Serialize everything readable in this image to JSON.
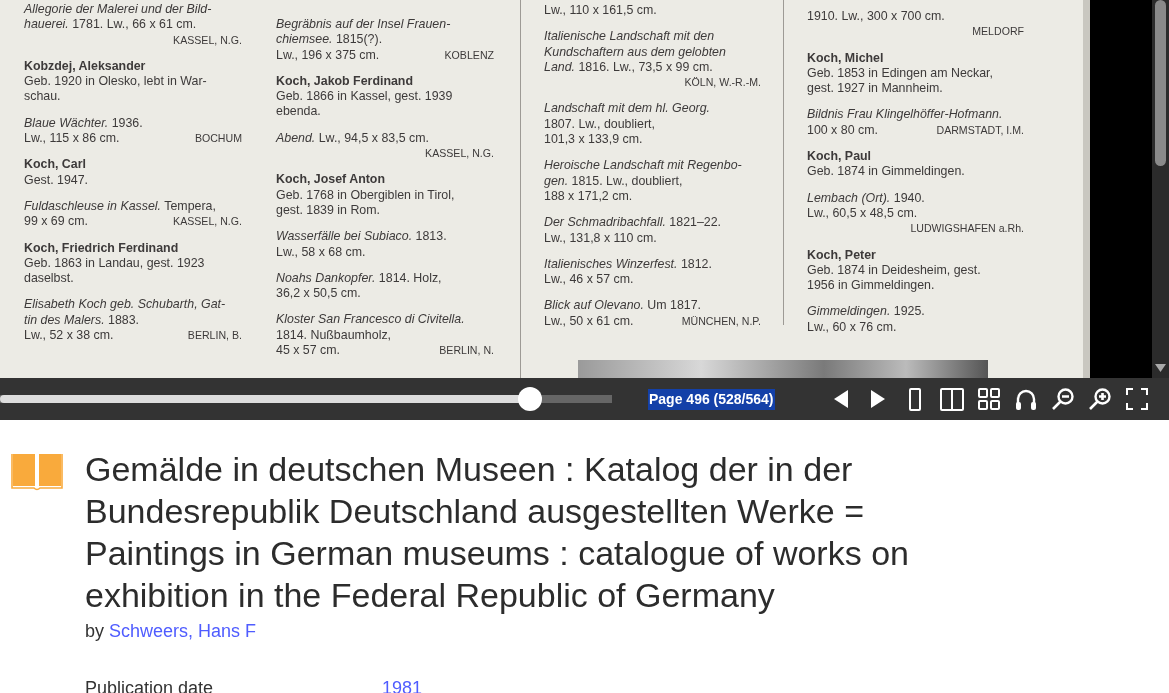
{
  "viewer": {
    "columns": [
      {
        "entries": [
          {
            "kind": "work",
            "lines": [
              {
                "text": "*Allegorie der Malerei und der Bild-*"
              },
              {
                "text": "*hauerei.* 1781. Lw., 66 x 61 cm."
              },
              {
                "location": "KASSEL, N.G."
              }
            ]
          },
          {
            "kind": "artist",
            "name": "Kobzdej, Aleksander",
            "lines": [
              {
                "text": "Geb. 1920 in Olesko, lebt in War-"
              },
              {
                "text": "schau."
              }
            ]
          },
          {
            "kind": "work",
            "lines": [
              {
                "text": "*Blaue Wächter.* 1936."
              },
              {
                "text": "Lw., 115 x 86 cm.",
                "location": "BOCHUM"
              }
            ]
          },
          {
            "kind": "artist",
            "name": "Koch, Carl",
            "lines": [
              {
                "text": "Gest. 1947."
              }
            ]
          },
          {
            "kind": "work",
            "lines": [
              {
                "text": "*Fuldaschleuse in Kassel.* Tempera,"
              },
              {
                "text": "99 x 69 cm.",
                "location": "KASSEL, N.G."
              }
            ]
          },
          {
            "kind": "artist",
            "name": "Koch, Friedrich Ferdinand",
            "lines": [
              {
                "text": "Geb. 1863 in Landau, gest. 1923"
              },
              {
                "text": "daselbst."
              }
            ]
          },
          {
            "kind": "work",
            "lines": [
              {
                "text": "*Elisabeth Koch geb. Schubarth, Gat-*"
              },
              {
                "text": "*tin des Malers.* 1883."
              },
              {
                "text": "Lw., 52 x 38 cm.",
                "location": "BERLIN, B."
              }
            ]
          }
        ]
      },
      {
        "entries": [
          {
            "kind": "work",
            "lines": [
              {
                "text": "*Begräbnis auf der Insel Frauen-*"
              },
              {
                "text": "*chiemsee.* 1815(?)."
              },
              {
                "text": "Lw., 196 x 375 cm.",
                "location": "KOBLENZ"
              }
            ]
          },
          {
            "kind": "artist",
            "name": "Koch, Jakob Ferdinand",
            "lines": [
              {
                "text": "Geb. 1866 in Kassel, gest. 1939"
              },
              {
                "text": "ebenda."
              }
            ]
          },
          {
            "kind": "work",
            "lines": [
              {
                "text": "*Abend.* Lw., 94,5 x 83,5 cm."
              },
              {
                "location": "KASSEL, N.G."
              }
            ]
          },
          {
            "kind": "artist",
            "name": "Koch, Josef Anton",
            "lines": [
              {
                "text": "Geb. 1768 in Obergiblen in Tirol,"
              },
              {
                "text": "gest. 1839 in Rom."
              }
            ]
          },
          {
            "kind": "work",
            "lines": [
              {
                "text": "*Wasserfälle bei Subiaco.* 1813."
              },
              {
                "text": "Lw., 58 x 68 cm."
              }
            ]
          },
          {
            "kind": "work",
            "lines": [
              {
                "text": "*Noahs Dankopfer.* 1814. Holz,"
              },
              {
                "text": "36,2 x 50,5 cm."
              }
            ]
          },
          {
            "kind": "work",
            "lines": [
              {
                "text": "*Kloster San Francesco di Civitella.*"
              },
              {
                "text": "1814. Nußbaumholz,"
              },
              {
                "text": "45 x 57 cm.",
                "location": "BERLIN, N."
              }
            ]
          }
        ]
      },
      {
        "entries": [
          {
            "kind": "work",
            "lines": [
              {
                "text": "Lw., 110 x 161,5 cm."
              }
            ]
          },
          {
            "kind": "work",
            "lines": [
              {
                "text": "*Italienische Landschaft mit den*"
              },
              {
                "text": "*Kundschaftern aus dem gelobten*"
              },
              {
                "text": "*Land.* 1816. Lw., 73,5 x 99 cm."
              },
              {
                "location": "KÖLN, W.-R.-M."
              }
            ]
          },
          {
            "kind": "work",
            "lines": [
              {
                "text": "*Landschaft mit dem hl. Georg.*"
              },
              {
                "text": "1807. Lw., doubliert,"
              },
              {
                "text": "101,3 x 133,9  cm."
              }
            ]
          },
          {
            "kind": "work",
            "lines": [
              {
                "text": "*Heroische Landschaft mit Regenbo-*"
              },
              {
                "text": "*gen.* 1815. Lw., doubliert,"
              },
              {
                "text": "188 x 171,2 cm."
              }
            ]
          },
          {
            "kind": "work",
            "lines": [
              {
                "text": "*Der Schmadribachfall.* 1821–22."
              },
              {
                "text": "Lw., 131,8 x 110 cm."
              }
            ]
          },
          {
            "kind": "work",
            "lines": [
              {
                "text": "*Italienisches Winzerfest.* 1812."
              },
              {
                "text": "Lw., 46 x 57 cm."
              }
            ]
          },
          {
            "kind": "work",
            "lines": [
              {
                "text": "*Blick auf Olevano.* Um 1817."
              },
              {
                "text": "Lw., 50 x 61 cm.",
                "location": "MÜNCHEN, N.P."
              }
            ]
          }
        ]
      },
      {
        "entries": [
          {
            "kind": "work",
            "lines": [
              {
                "text": "1910. Lw., 300 x 700 cm."
              },
              {
                "location": "MELDORF"
              }
            ]
          },
          {
            "kind": "artist",
            "name": "Koch, Michel",
            "lines": [
              {
                "text": "Geb. 1853 in Edingen am Neckar,"
              },
              {
                "text": "gest. 1927 in Mannheim."
              }
            ]
          },
          {
            "kind": "work",
            "lines": [
              {
                "text": "*Bildnis Frau Klingelhöffer-Hofmann.*"
              },
              {
                "text": "100 x 80 cm.",
                "location": "DARMSTADT, I.M."
              }
            ]
          },
          {
            "kind": "artist",
            "name": "Koch, Paul",
            "lines": [
              {
                "text": "Geb. 1874 in Gimmeldingen."
              }
            ]
          },
          {
            "kind": "work",
            "lines": [
              {
                "text": "*Lembach (Ort).* 1940."
              },
              {
                "text": "Lw., 60,5 x 48,5 cm."
              },
              {
                "location": "LUDWIGSHAFEN a.Rh."
              }
            ]
          },
          {
            "kind": "artist",
            "name": "Koch, Peter",
            "lines": [
              {
                "text": "Geb. 1874 in Deidesheim, gest."
              },
              {
                "text": "1956 in Gimmeldingen."
              }
            ]
          },
          {
            "kind": "work",
            "lines": [
              {
                "text": "*Gimmeldingen.* 1925."
              },
              {
                "text": "Lw., 60 x 76 cm."
              }
            ]
          }
        ]
      }
    ]
  },
  "toolbar": {
    "slider": {
      "level": 0.866
    },
    "page_label": "Page 496 (528/564)"
  },
  "item": {
    "title": "Gemälde in deutschen Museen : Katalog der in der Bundesrepublik Deutschland ausgestellten Werke = Paintings in German museums : catalogue of works on exhibition in the Federal Republic of Germany",
    "by_label": "by",
    "author": "Schweers, Hans F",
    "metadata": [
      {
        "label": "Publication date",
        "value": "1981"
      }
    ]
  }
}
